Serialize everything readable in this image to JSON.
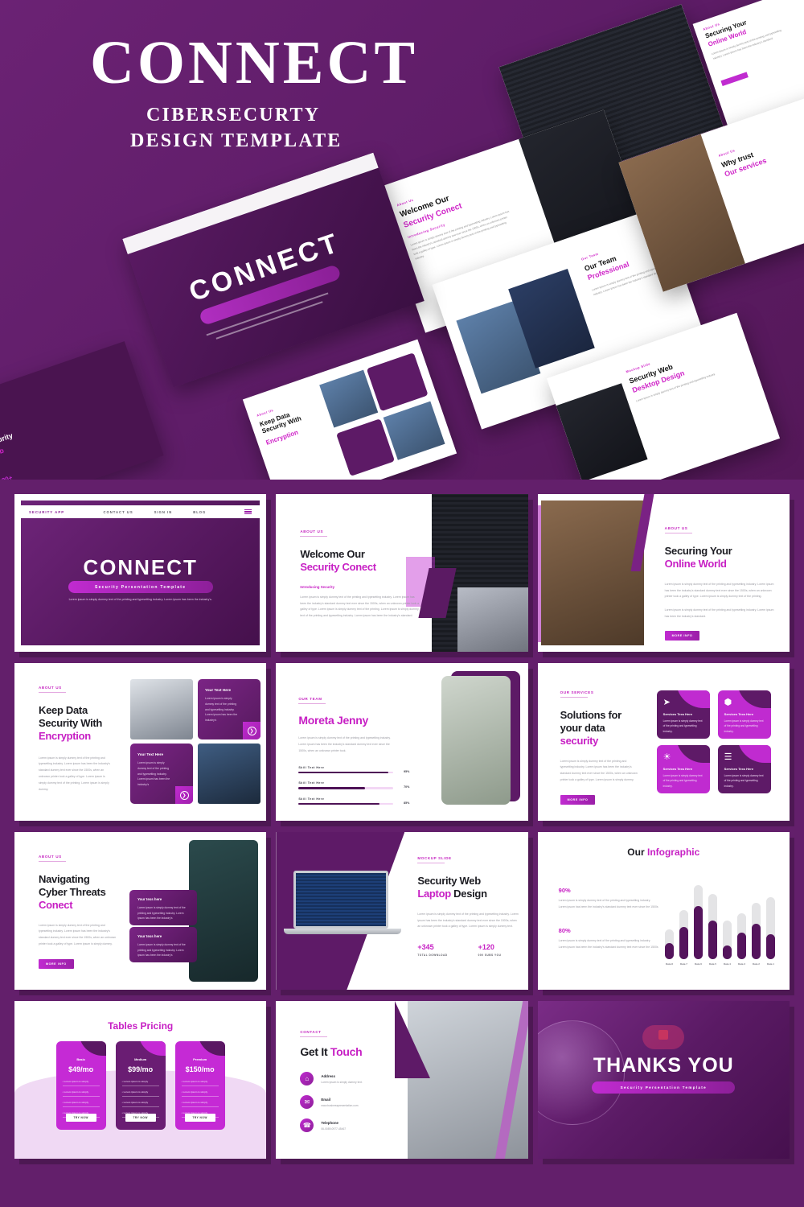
{
  "hero": {
    "title": "CONNECT",
    "subtitle_line1": "CIBERSECURTY",
    "subtitle_line2": "DESIGN TEMPLATE",
    "mini_slides": [
      {
        "title": "CONNECT",
        "pill": "Security Persentation Template"
      },
      {
        "eyebrow": "About Us",
        "title_dark": "Welcome Our",
        "title_pink": "Security Conect",
        "sub": "Introducing Security"
      },
      {
        "eyebrow": "Our Team",
        "title_dark": "Our Team",
        "title_pink": "Professional",
        "sub": "Your Text Here"
      },
      {
        "eyebrow": "About Us",
        "title_dark": "Securing Your",
        "title_pink": "Online World"
      },
      {
        "eyebrow": "About Us",
        "title_dark": "Why trust",
        "title_pink": "Our services"
      },
      {
        "eyebrow": "Mockup Slide",
        "title_dark": "Security Web",
        "title_pink": "Desktop Design"
      },
      {
        "eyebrow": "About Us",
        "title_dark": "Keep Data Security With",
        "title_pink": "Encryption"
      },
      {
        "title_pink": "Your Text Here"
      },
      {
        "eyebrow": "Services Text",
        "title_pink": "Services"
      }
    ],
    "nav": [
      "CONTACT US",
      "SIGN IN",
      "BLOG"
    ],
    "stat": "120+"
  },
  "colors": {
    "background": "#631f6b",
    "accent_magenta": "#c71fc4",
    "deep_purple": "#4e1356",
    "light_pink": "#f0d9f4"
  },
  "slides": {
    "cover": {
      "brand": "SECURITY APP",
      "nav": [
        "CONTACT US",
        "SIGN IN",
        "BLOG"
      ],
      "title": "CONNECT",
      "pill": "Security Persentation Template",
      "body": "Lorem ipsum is simply dummy text of the printing and typesetting industry. Lorem ipsum has been the industry's."
    },
    "welcome": {
      "eyebrow": "About Us",
      "title_dark": "Welcome Our",
      "title_pink": "Security Conect",
      "subheading": "Introducing Security",
      "body": "Lorem ipsum is simply dummy text of the printing and typesetting industry. Lorem ipsum has been the industry's standard dummy text ever since the 1500s, when an unknown printer took a galley of type. Lorem ipsum is simply dummy text of the printing. Lorem ipsum is simply dummy text of the printing and typesetting industry. Lorem ipsum has been the industry's standard."
    },
    "securing": {
      "eyebrow": "About Us",
      "title_dark": "Securing Your",
      "title_pink": "Online World",
      "body1": "Lorem ipsum is simply dummy text of the printing and typesetting industry. Lorem ipsum has been the industry's standard dummy text ever since the 1500s, when an unknown printer took a galley of type. Lorem ipsum is simply dummy text of the printing.",
      "body2": "Lorem ipsum is simply dummy text of the printing and typesetting industry. Lorem ipsum has been the industry's standard.",
      "button": "MORE INFO"
    },
    "encryption": {
      "eyebrow": "About Us",
      "title_line1": "Keep Data",
      "title_line2": "Security With",
      "title_pink": "Encryption",
      "body": "Lorem ipsum is simply dummy text of the printing and typesetting industry. Lorem ipsum has been the industry's standard dummy text ever since the 1500s, when an unknown printer took a galley of type. Lorem ipsum is simply dummy text of the printing. Lorem ipsum is simply dummy.",
      "cards": [
        {
          "title": "Your Text Here",
          "body": "Lorem ipsum is simply dummy text of the printing and typesetting industry. Lorem ipsum has been the industry's"
        },
        {
          "title": "Your Text Here",
          "body": "Lorem ipsum is simply dummy text of the printing and typesetting industry. Lorem ipsum has been the industry's"
        }
      ]
    },
    "team_member": {
      "eyebrow": "Our Team",
      "name": "Moreta Jenny",
      "body": "Lorem ipsum is simply dummy text of the printing and typesetting industry. Lorem ipsum has been the industry's standard dummy text ever since the 1500s, when an unknown printer took.",
      "skills": [
        {
          "label": "Skill Text Here",
          "pct": 95,
          "pct_label": "95%"
        },
        {
          "label": "Skill Text Here",
          "pct": 70,
          "pct_label": "70%"
        },
        {
          "label": "Skill Text Here",
          "pct": 85,
          "pct_label": "85%"
        }
      ]
    },
    "solutions": {
      "eyebrow": "Our Services",
      "title_line1": "Solutions for",
      "title_line2": "your data",
      "title_pink": "security",
      "body": "Lorem ipsum is simply dummy text of the printing and typesetting industry. Lorem ipsum has been the industry's standard dummy text ever since the 1500s, when an unknown printer took a galley of type. Lorem ipsum is simply dummy.",
      "button": "MORE INFO",
      "services": [
        {
          "icon": "send-icon",
          "glyph": "➤",
          "title": "Services Texs Here",
          "body": "Lorem ipsum is simply dummy text of the printing and typesetting industry."
        },
        {
          "icon": "shield-icon",
          "glyph": "⬢",
          "title": "Services Texs Here",
          "body": "Lorem ipsum is simply dummy text of the printing and typesetting industry."
        },
        {
          "icon": "settings-icon",
          "glyph": "☀",
          "title": "Services Texs Here",
          "body": "Lorem ipsum is simply dummy text of the printing and typesetting industry."
        },
        {
          "icon": "layers-icon",
          "glyph": "☰",
          "title": "Services Texs Here",
          "body": "Lorem ipsum is simply dummy text of the printing and typesetting industry."
        }
      ]
    },
    "navigating": {
      "eyebrow": "About Us",
      "title_line1": "Navigating",
      "title_line2": "Cyber Threats",
      "title_pink": "Conect",
      "body": "Lorem ipsum is simply dummy text of the printing and typesetting industry. Lorem ipsum has been the industry's standard dummy text ever since the 1500s, when an unknown printer took a galley of type. Lorem ipsum is simply dummy.",
      "button": "MORE INFO",
      "cards": [
        {
          "title": "Your texs here",
          "body": "Lorem ipsum is simply dummy text of the printing and typesetting industry. Lorem ipsum has been the industry's"
        },
        {
          "title": "Your texs here",
          "body": "Lorem ipsum is simply dummy text of the printing and typesetting industry. Lorem ipsum has been the industry's"
        }
      ]
    },
    "laptop": {
      "eyebrow": "Mockup Slide",
      "title_dark": "Security Web",
      "title_pink": "Laptop",
      "title_dark2": "Design",
      "body": "Lorem ipsum is simply dummy text of the printing and typesetting industry. Lorem ipsum has been the industry's standard dummy text ever since the 1500s, when an unknown printer took a galley of type. Lorem ipsum is simply dummy text.",
      "stats": [
        {
          "value": "+345",
          "label": "TOTAL DOWNLOAD"
        },
        {
          "value": "+120",
          "label": "000 SUBS YOU"
        }
      ]
    },
    "infographic": {
      "title_dark": "Our",
      "title_pink": "Infographic",
      "blocks": [
        {
          "pct": "90%",
          "body": "Lorem ipsum is simply dummy text of the printing and typesetting industry. Lorem ipsum has been the industry's standard dummy text ever since the 1500s"
        },
        {
          "pct": "80%",
          "body": "Lorem ipsum is simply dummy text of the printing and typesetting industry. Lorem ipsum has been the industry's standard dummy text ever since the 1500s"
        }
      ]
    },
    "pricing": {
      "title": "Tables Pricing",
      "plans": [
        {
          "name": "Basic",
          "price": "$49/mo",
          "features": [
            "Lorem ipsum is simply",
            "Lorem ipsum is simply",
            "Lorem ipsum is simply",
            "Lorem ipsum is simply"
          ],
          "button": "TRY NOW"
        },
        {
          "name": "Medium",
          "price": "$99/mo",
          "features": [
            "Lorem ipsum is simply",
            "Lorem ipsum is simply",
            "Lorem ipsum is simply",
            "Lorem ipsum is simply"
          ],
          "button": "TRY NOW"
        },
        {
          "name": "Premium",
          "price": "$150/mo",
          "features": [
            "Lorem ipsum is simply",
            "Lorem ipsum is simply",
            "Lorem ipsum is simply",
            "Lorem ipsum is simply"
          ],
          "button": "TRY NOW"
        }
      ]
    },
    "contact": {
      "eyebrow": "Contact",
      "title_dark": "Get It",
      "title_pink": "Touch",
      "items": [
        {
          "icon": "home-icon",
          "glyph": "⌂",
          "label": "Address",
          "value": "Lorem ipsum is simply dummy text."
        },
        {
          "icon": "mail-icon",
          "glyph": "✉",
          "label": "Email",
          "value": "www.businesspresentation.com"
        },
        {
          "icon": "phone-icon",
          "glyph": "☎",
          "label": "Telephone",
          "value": "06-0089-0977-45467"
        }
      ]
    },
    "thanks": {
      "title": "THANKS YOU",
      "pill": "Security Persentation Template",
      "icon": "cloud-lock-icon"
    }
  },
  "chart_data": {
    "type": "bar",
    "title": "Our Infographic",
    "categories": [
      "Data 8",
      "Data 7",
      "Data 6",
      "Data 5",
      "Data 4",
      "Data 3",
      "Data 2",
      "Data 1"
    ],
    "values": [
      22,
      44,
      72,
      52,
      18,
      36,
      48,
      34
    ],
    "track_values": [
      40,
      66,
      100,
      88,
      52,
      62,
      76,
      84
    ],
    "ylim": [
      0,
      100
    ],
    "grid": false,
    "legend": null,
    "xlabel": "",
    "ylabel": ""
  }
}
